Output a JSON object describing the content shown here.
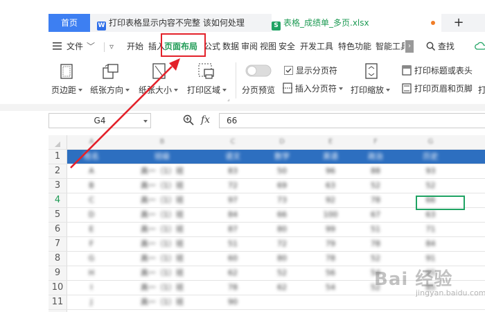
{
  "tabs": {
    "home": "首页",
    "word_doc": "打印表格显示内容不完整 该如何处理",
    "excel_doc": "表格_成绩单_多页.xlsx",
    "new_tab": "+"
  },
  "menu": {
    "file": "文件",
    "items": [
      "开始",
      "插入",
      "页面布局",
      "公式",
      "数据",
      "审阅",
      "视图",
      "安全",
      "开发工具",
      "特色功能",
      "智能工具"
    ],
    "search": "查找"
  },
  "ribbon": {
    "margins": "页边距",
    "orientation": "纸张方向",
    "size": "纸张大小",
    "print_area": "打印区域",
    "page_break_preview": "分页预览",
    "show_page_breaks": "显示分页符",
    "insert_page_break": "插入分页符",
    "print_scale": "打印缩放",
    "print_titles": "打印标题或表头",
    "header_footer": "打印页眉和页脚",
    "print_more": "打"
  },
  "formula_bar": {
    "cell_ref": "G4",
    "fx": "fx",
    "value": "66"
  },
  "grid": {
    "col_letters": [
      "A",
      "B",
      "C",
      "D",
      "E",
      "F",
      "G"
    ],
    "header_row": [
      "姓名",
      "班级",
      "语文",
      "数学",
      "英语",
      "政治",
      "历史"
    ],
    "rows": [
      [
        "A",
        "高一（1）班",
        "83",
        "50",
        "96",
        "88",
        "93"
      ],
      [
        "B",
        "高一（1）班",
        "72",
        "69",
        "63",
        "52",
        "52"
      ],
      [
        "C",
        "高一（1）班",
        "97",
        "73",
        "92",
        "78",
        "66"
      ],
      [
        "D",
        "高一（1）班",
        "84",
        "66",
        "100",
        "67",
        "63"
      ],
      [
        "E",
        "高一（1）班",
        "87",
        "80",
        "99",
        "51",
        "71"
      ],
      [
        "F",
        "高一（1）班",
        "51",
        "72",
        "79",
        "78",
        "84"
      ],
      [
        "G",
        "高一（1）班",
        "60",
        "80",
        "78",
        "52",
        "91"
      ],
      [
        "H",
        "高一（1）班",
        "62",
        "52",
        "56",
        "54",
        "65"
      ],
      [
        "I",
        "高一（1）班",
        "78",
        "62",
        "54",
        "52",
        "85"
      ],
      [
        "J",
        "高一（1）班",
        "90",
        "",
        "",
        "",
        ""
      ]
    ],
    "row_numbers": [
      "1",
      "2",
      "3",
      "4",
      "5",
      "6",
      "7",
      "8",
      "9",
      "10",
      "11"
    ],
    "active_row": "4"
  },
  "watermark": {
    "brand": "Bai 经验",
    "url": "jingyan.baidu.com"
  },
  "colors": {
    "accent_blue": "#3d7ff2",
    "excel_green": "#1fa363",
    "highlight_red": "#e3212a",
    "header_blue": "#2d6fc0"
  }
}
